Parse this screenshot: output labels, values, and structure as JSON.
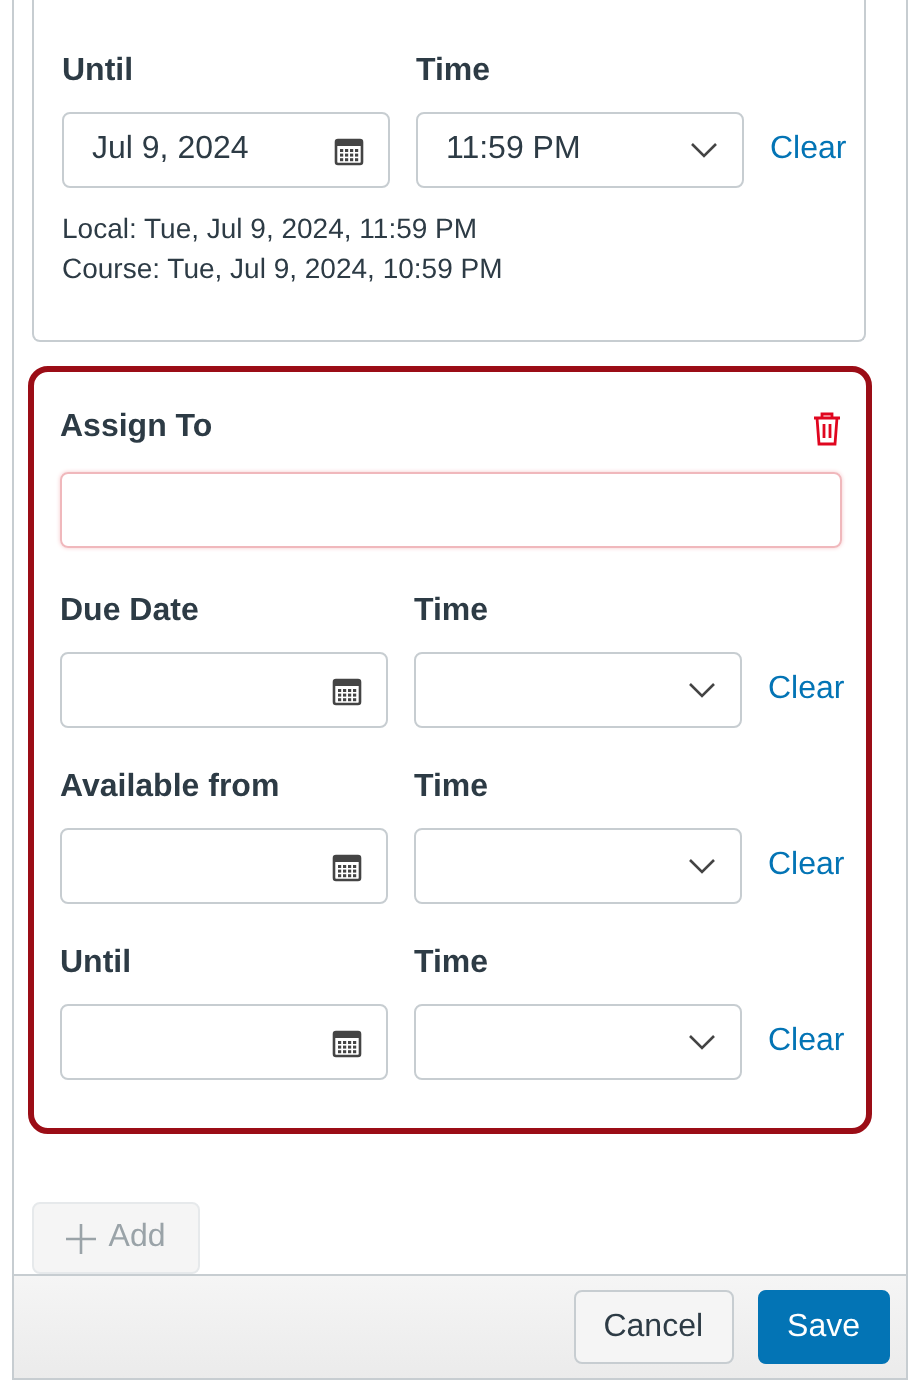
{
  "top_card": {
    "rows": [
      {
        "date_label": "Until",
        "time_label": "Time",
        "date": "Jul 9, 2024",
        "time": "11:59 PM",
        "clear": "Clear"
      }
    ],
    "local_time": "Local: Tue, Jul 9, 2024, 11:59 PM",
    "course_time": "Course: Tue, Jul 9, 2024, 10:59 PM"
  },
  "assign_card": {
    "highlighted": true,
    "assign_label": "Assign To",
    "assign_invalid": true,
    "rows": [
      {
        "date_label": "Due Date",
        "time_label": "Time",
        "clear": "Clear"
      },
      {
        "date_label": "Available from",
        "time_label": "Time",
        "clear": "Clear"
      },
      {
        "date_label": "Until",
        "time_label": "Time",
        "clear": "Clear"
      }
    ]
  },
  "add_button": {
    "label": "Add",
    "disabled": true
  },
  "footer": {
    "buttons": [
      {
        "label": "Cancel",
        "kind": "secondary"
      },
      {
        "label": "Save",
        "kind": "primary"
      }
    ]
  }
}
